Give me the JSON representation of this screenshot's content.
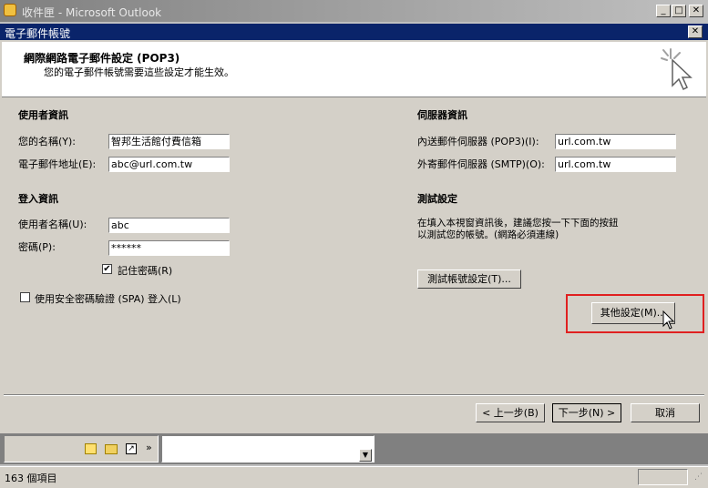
{
  "outlook": {
    "window_title": "收件匣 - Microsoft Outlook",
    "status_text": "163 個項目"
  },
  "dialog": {
    "title": "電子郵件帳號",
    "header_title": "網際網路電子郵件設定 (POP3)",
    "header_subtitle": "您的電子郵件帳號需要這些設定才能生效。"
  },
  "user_info": {
    "heading": "使用者資訊",
    "name_label": "您的名稱(Y):",
    "name_value": "智邦生活館付費信箱",
    "email_label": "電子郵件地址(E):",
    "email_value": "abc@url.com.tw"
  },
  "login_info": {
    "heading": "登入資訊",
    "username_label": "使用者名稱(U):",
    "username_value": "abc",
    "password_label": "密碼(P):",
    "password_value": "******",
    "remember_label": "記住密碼(R)",
    "remember_checked": true,
    "spa_label": "使用安全密碼驗證 (SPA) 登入(L)",
    "spa_checked": false
  },
  "server_info": {
    "heading": "伺服器資訊",
    "incoming_label": "內送郵件伺服器 (POP3)(I):",
    "incoming_value": "url.com.tw",
    "outgoing_label": "外寄郵件伺服器 (SMTP)(O):",
    "outgoing_value": "url.com.tw"
  },
  "test": {
    "heading": "測試設定",
    "description_line1": "在填入本視窗資訊後，建議您按一下下面的按鈕",
    "description_line2": "以測試您的帳號。(網路必須連線)",
    "test_button": "測試帳號設定(T)..."
  },
  "more_settings_button": "其他設定(M)...",
  "nav": {
    "back_button": "< 上一步(B)",
    "next_button": "下一步(N) >",
    "cancel_button": "取消"
  },
  "colors": {
    "titlebar": "#0a246a",
    "highlight_box": "#e02020",
    "dialog_bg": "#d4d0c8"
  }
}
